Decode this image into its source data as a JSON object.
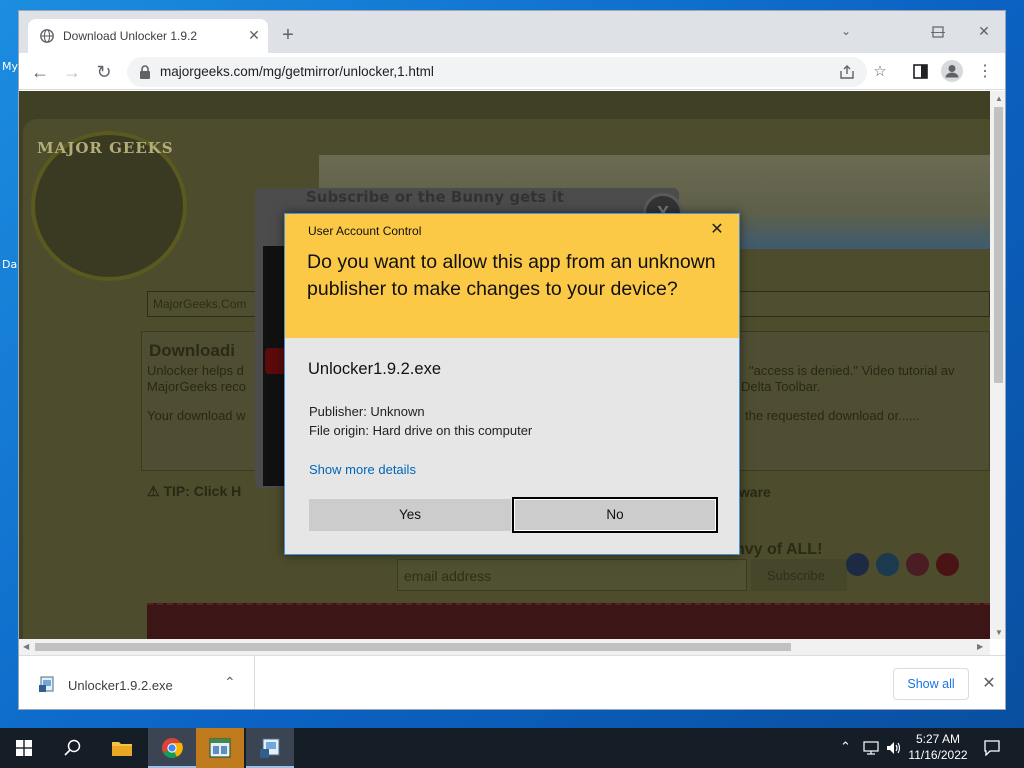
{
  "desktop": {
    "icon_labels": [
      "My",
      "Da"
    ]
  },
  "browser": {
    "tab_title": "Download Unlocker 1.9.2",
    "url": "majorgeeks.com/mg/getmirror/unlocker,1.html"
  },
  "page": {
    "logo_text": "MAJOR GEEKS",
    "search_placeholder": "MajorGeeks.Com",
    "heading": "Downloadi",
    "line1_left": "Unlocker helps d",
    "line1_right": "\"access is denied.\" Video tutorial av",
    "line2_left": "MajorGeeks reco",
    "line2_right": "Delta Toolbar.",
    "line3_left": "Your download w",
    "line3_right": "the requested download or......",
    "tip": "TIP: Click H",
    "tip_right": "lware",
    "envy": "nvy of ALL!",
    "email_placeholder": "email address",
    "subscribe_btn": "Subscribe",
    "popup_title": "Subscribe or the Bunny gets it",
    "popup_close": "X"
  },
  "uac": {
    "caption": "User Account Control",
    "question": "Do you want to allow this app from an unknown publisher to make changes to your device?",
    "app_name": "Unlocker1.9.2.exe",
    "publisher": "Publisher: Unknown",
    "origin": "File origin: Hard drive on this computer",
    "more_details": "Show more details",
    "yes": "Yes",
    "no": "No"
  },
  "download_bar": {
    "file_name": "Unlocker1.9.2.exe",
    "show_all": "Show all"
  },
  "taskbar": {
    "time": "5:27 AM",
    "date": "11/16/2022"
  },
  "colors": {
    "uac_header": "#fcc946",
    "link_blue": "#0067b8",
    "chrome_blue": "#1a73e8",
    "taskbar": "#151d27"
  }
}
